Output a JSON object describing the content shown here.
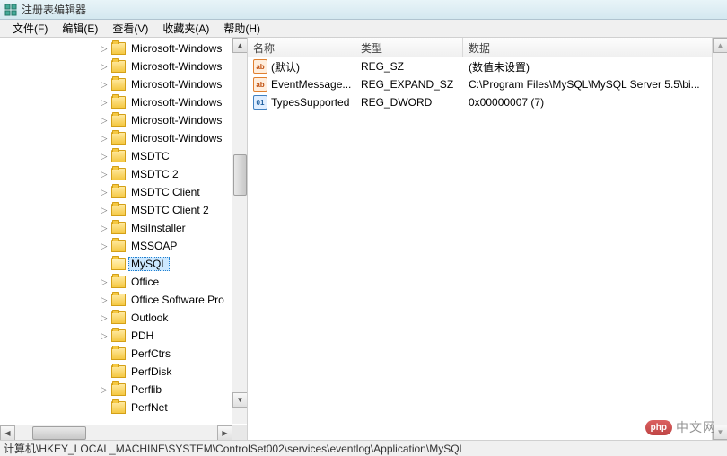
{
  "window": {
    "title": "注册表编辑器"
  },
  "menu": {
    "file": "文件(F)",
    "edit": "编辑(E)",
    "view": "查看(V)",
    "favorites": "收藏夹(A)",
    "help": "帮助(H)"
  },
  "tree": {
    "items": [
      {
        "label": "Microsoft-Windows",
        "expandable": true,
        "level": 3
      },
      {
        "label": "Microsoft-Windows",
        "expandable": true,
        "level": 3
      },
      {
        "label": "Microsoft-Windows",
        "expandable": true,
        "level": 3
      },
      {
        "label": "Microsoft-Windows",
        "expandable": true,
        "level": 3
      },
      {
        "label": "Microsoft-Windows",
        "expandable": true,
        "level": 3
      },
      {
        "label": "Microsoft-Windows",
        "expandable": true,
        "level": 3
      },
      {
        "label": "MSDTC",
        "expandable": true,
        "level": 3
      },
      {
        "label": "MSDTC 2",
        "expandable": true,
        "level": 3
      },
      {
        "label": "MSDTC Client",
        "expandable": true,
        "level": 3
      },
      {
        "label": "MSDTC Client 2",
        "expandable": true,
        "level": 3
      },
      {
        "label": "MsiInstaller",
        "expandable": true,
        "level": 3
      },
      {
        "label": "MSSOAP",
        "expandable": true,
        "level": 3
      },
      {
        "label": "MySQL",
        "expandable": false,
        "level": 3,
        "selected": true
      },
      {
        "label": "Office",
        "expandable": true,
        "level": 3
      },
      {
        "label": "Office Software Pro",
        "expandable": true,
        "level": 3
      },
      {
        "label": "Outlook",
        "expandable": true,
        "level": 3
      },
      {
        "label": "PDH",
        "expandable": true,
        "level": 3
      },
      {
        "label": "PerfCtrs",
        "expandable": false,
        "level": 3
      },
      {
        "label": "PerfDisk",
        "expandable": false,
        "level": 3
      },
      {
        "label": "Perflib",
        "expandable": true,
        "level": 3
      },
      {
        "label": "PerfNet",
        "expandable": false,
        "level": 3
      }
    ]
  },
  "list": {
    "headers": {
      "name": "名称",
      "type": "类型",
      "data": "数据"
    },
    "rows": [
      {
        "icon": "sz",
        "name": "(默认)",
        "type": "REG_SZ",
        "data": "(数值未设置)"
      },
      {
        "icon": "sz",
        "name": "EventMessage...",
        "type": "REG_EXPAND_SZ",
        "data": "C:\\Program Files\\MySQL\\MySQL Server 5.5\\bi..."
      },
      {
        "icon": "dw",
        "name": "TypesSupported",
        "type": "REG_DWORD",
        "data": "0x00000007 (7)"
      }
    ]
  },
  "statusbar": {
    "path": "计算机\\HKEY_LOCAL_MACHINE\\SYSTEM\\ControlSet002\\services\\eventlog\\Application\\MySQL"
  },
  "watermark": {
    "badge": "php",
    "text": "中文网"
  },
  "icon_labels": {
    "sz": "ab",
    "dw": "011\n110"
  }
}
